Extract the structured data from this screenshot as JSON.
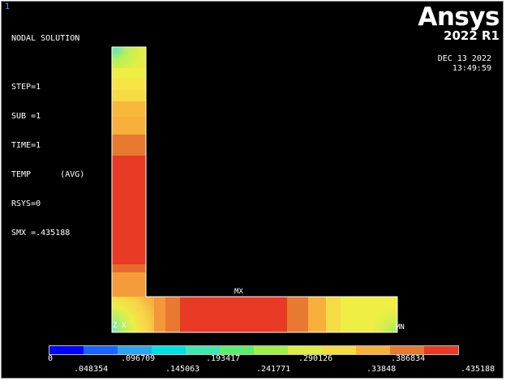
{
  "window_number": "1",
  "info_lines": [
    "NODAL SOLUTION",
    "",
    "STEP=1",
    "SUB =1",
    "TIME=1",
    "TEMP      (AVG)",
    "RSYS=0",
    "SMX =.435188"
  ],
  "brand": "Ansys",
  "version": "2022 R1",
  "date": "DEC 13 2022",
  "time": "13:49:59",
  "labels": {
    "max": "MX",
    "min": "MN",
    "axis": "Z X"
  },
  "colors": {
    "background": "#000000",
    "legend": [
      "#0000ff",
      "#1a66ff",
      "#2aa6f0",
      "#00e0e0",
      "#40e8b0",
      "#5aee6e",
      "#9ef04a",
      "#dcee44",
      "#f6dc44",
      "#f8b03c",
      "#e77a30",
      "#e83a24"
    ]
  },
  "legend_ticks": {
    "upper": [
      "0",
      ".096709",
      ".193417",
      ".290126",
      ".386834"
    ],
    "lower": [
      ".048354",
      ".145063",
      ".241771",
      ".33848",
      ".435188"
    ]
  }
}
